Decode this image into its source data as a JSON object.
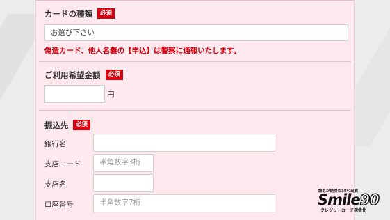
{
  "card_type": {
    "label": "カードの種類",
    "required_badge": "必須",
    "select_value": "お選び下さい",
    "warning": "偽造カード、他人名義の【申込】は警察に通報いたします。"
  },
  "amount": {
    "label": "ご利用希望金額",
    "required_badge": "必須",
    "value": "",
    "unit": "円"
  },
  "transfer": {
    "label": "振込先",
    "required_badge": "必須",
    "bank_name": {
      "label": "銀行名",
      "value": ""
    },
    "branch_code": {
      "label": "支店コード",
      "placeholder": "半角数字3桁"
    },
    "branch_name": {
      "label": "支店名",
      "value": ""
    },
    "account_number": {
      "label": "口座番号",
      "placeholder": "半角数字7桁"
    }
  },
  "logo": {
    "tagline": "誰もが納得の35%出資",
    "word": "Smile",
    "number": "90",
    "subline": "クレジットカード現金化"
  }
}
